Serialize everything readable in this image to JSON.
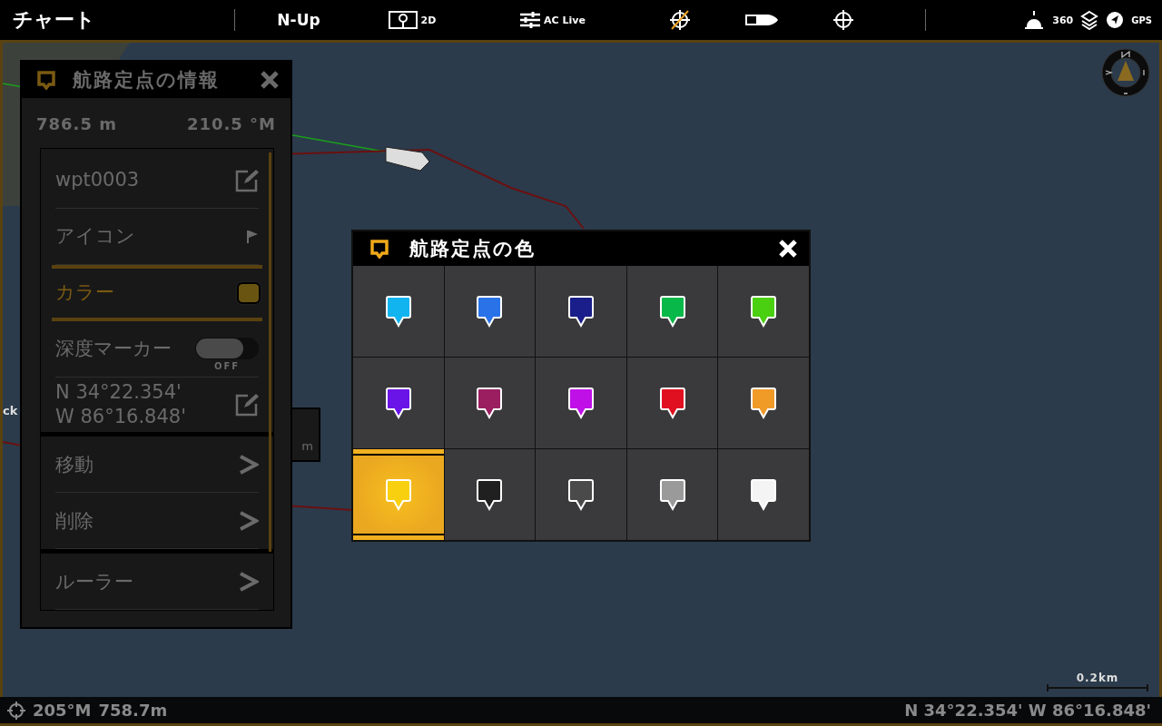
{
  "top_bar": {
    "title": "チャート",
    "orientation": "N-Up",
    "view_mode": "2D",
    "ac_live": "AC Live",
    "status_icons": [
      "360",
      "GPS"
    ]
  },
  "map": {
    "labels": [
      "ck"
    ],
    "popup_value": "m",
    "scale": "0.2km"
  },
  "info_panel": {
    "title": "航路定点の情報",
    "distance": "786.5 m",
    "bearing": "210.5 °M",
    "dimmed": true,
    "rows": [
      {
        "kind": "edit",
        "label": "wpt0003",
        "selected": false
      },
      {
        "kind": "icon",
        "label": "アイコン",
        "selected": false
      },
      {
        "kind": "color",
        "label": "カラー",
        "selected": true,
        "color": "#6a5412"
      },
      {
        "kind": "toggle",
        "label": "深度マーカー",
        "on": false,
        "state_label": "OFF",
        "selected": false
      },
      {
        "kind": "coords",
        "label": "N 34°22.354'",
        "label_2": "W 86°16.848'",
        "selected": false
      }
    ],
    "actions": [
      {
        "label": "移動"
      },
      {
        "label": "削除"
      }
    ],
    "extra_actions": [
      {
        "label": "ルーラー"
      }
    ]
  },
  "color_dialog": {
    "title": "航路定点の色",
    "colors": [
      {
        "color": "#12b4f0",
        "selected": false
      },
      {
        "color": "#2a72e8",
        "selected": false
      },
      {
        "color": "#1a1e8a",
        "selected": false
      },
      {
        "color": "#08b848",
        "selected": false
      },
      {
        "color": "#4ad010",
        "selected": false
      },
      {
        "color": "#6a14e8",
        "selected": false
      },
      {
        "color": "#9a1e60",
        "selected": false
      },
      {
        "color": "#c010e8",
        "selected": false
      },
      {
        "color": "#e01020",
        "selected": false
      },
      {
        "color": "#f09a28",
        "selected": false
      },
      {
        "color": "#f8d010",
        "selected": true
      },
      {
        "color": "#202020",
        "selected": false
      },
      {
        "color": "#4a4a4a",
        "selected": false
      },
      {
        "color": "#9a9a9a",
        "selected": false
      },
      {
        "color": "#f4f4f4",
        "selected": false
      }
    ]
  },
  "status_bar": {
    "bearing": "205°M",
    "distance": "758.7m",
    "position": "N 34°22.354' W 86°16.848'"
  }
}
